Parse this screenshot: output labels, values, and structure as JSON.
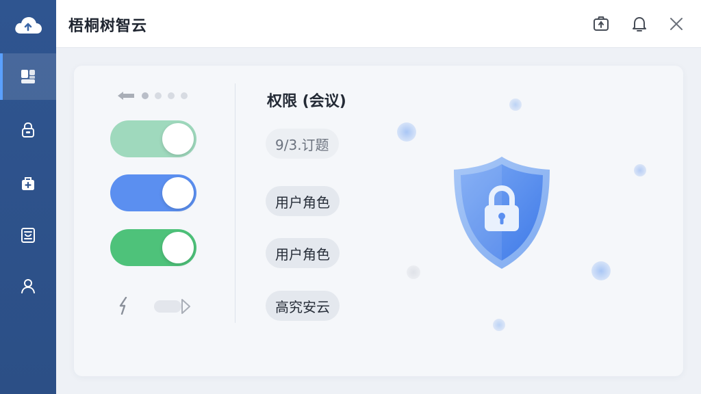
{
  "app": {
    "title": "梧桐树智云"
  },
  "sidebar": {
    "logo_icon": "cloud-icon",
    "items": [
      {
        "name": "dashboard",
        "icon": "dashboard-icon",
        "active": true
      },
      {
        "name": "lock",
        "icon": "lock-icon",
        "active": false
      },
      {
        "name": "toolbox",
        "icon": "toolbox-icon",
        "active": false
      },
      {
        "name": "reports",
        "icon": "report-icon",
        "active": false
      },
      {
        "name": "user",
        "icon": "user-icon",
        "active": false
      }
    ]
  },
  "topbar": {
    "actions": [
      "camera-icon",
      "bell-icon",
      "close-icon"
    ]
  },
  "left_controls": {
    "pager": {
      "pages": 4,
      "current": 1
    },
    "toggles": [
      {
        "name": "toggle-1",
        "on": true,
        "color": "#9fd9bd"
      },
      {
        "name": "toggle-2",
        "on": true,
        "color": "#5b8ff0"
      },
      {
        "name": "toggle-3",
        "on": true,
        "color": "#4ec27a"
      }
    ]
  },
  "permissions": {
    "title": "权限 (会议)",
    "chips": [
      {
        "label": "9/3.订题",
        "faded": true
      },
      {
        "label": "用户角色",
        "faded": false
      },
      {
        "label": "用户角色",
        "faded": false
      },
      {
        "label": "高究安云",
        "faded": false
      }
    ]
  },
  "illustration": {
    "icon": "shield-lock-icon",
    "accent": "#4f8ef2"
  },
  "colors": {
    "sidebar": "#2f5590",
    "accent": "#4f8ef2"
  }
}
